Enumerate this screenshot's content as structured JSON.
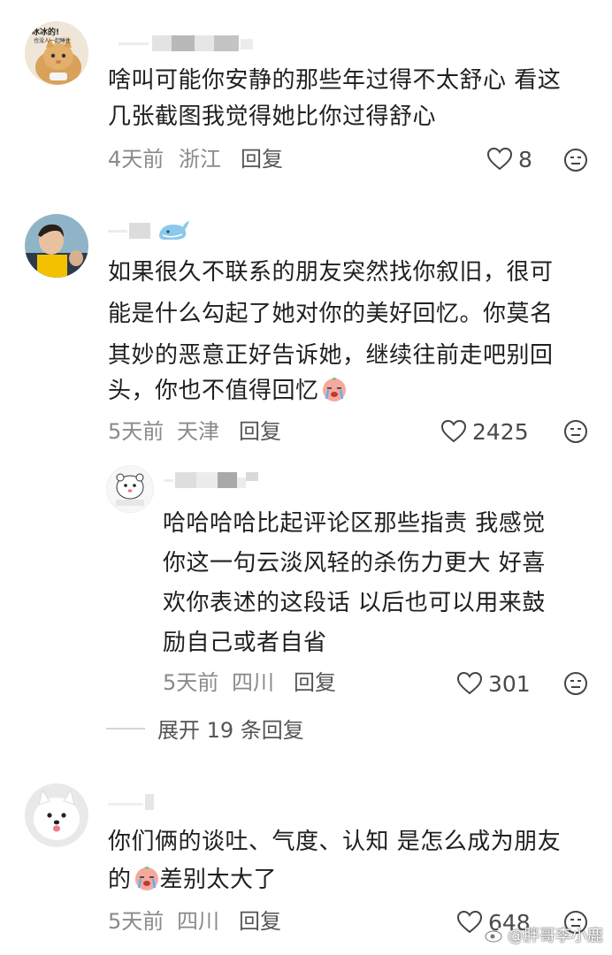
{
  "comments": [
    {
      "avatar_caption_line1": "冰冰的!",
      "avatar_caption_line2": "也没人一起睡住",
      "text_line1": "啥叫可能你安静的那些年过得不太舒心 看这",
      "text_line2": "几张截图我觉得她比你过得舒心",
      "time": "4天前",
      "location": "浙江",
      "reply_label": "回复",
      "likes": "8"
    },
    {
      "text_line1": "如果很久不联系的朋友突然找你叙旧，很可",
      "text_line2": "能是什么勾起了她对你的美好回忆。你莫名",
      "text_line3": "其妙的恶意正好告诉她，继续往前走吧别回",
      "text_line4": "头，你也不值得回忆",
      "time": "5天前",
      "location": "天津",
      "reply_label": "回复",
      "likes": "2425"
    },
    {
      "text_line1": "哈哈哈哈比起评论区那些指责 我感觉",
      "text_line2": "你这一句云淡风轻的杀伤力更大 好喜",
      "text_line3": "欢你表述的这段话 以后也可以用来鼓",
      "text_line4": "励自己或者自省",
      "time": "5天前",
      "location": "四川",
      "reply_label": "回复",
      "likes": "301"
    },
    {
      "text_line1": "你们俩的谈吐、气度、认知 是怎么成为朋友",
      "text_line2_prefix": "的",
      "text_line2_suffix": "差别太大了",
      "time": "5天前",
      "location": "四川",
      "reply_label": "回复",
      "likes": "648"
    }
  ],
  "expand_replies_label": "展开 19 条回复",
  "watermark": "@胖哥李小鹿",
  "icons": {
    "like": "heart-outline-icon",
    "dislike": "neutral-face-icon",
    "emoji": "crying-face-emoji",
    "badge": "whale-icon"
  }
}
